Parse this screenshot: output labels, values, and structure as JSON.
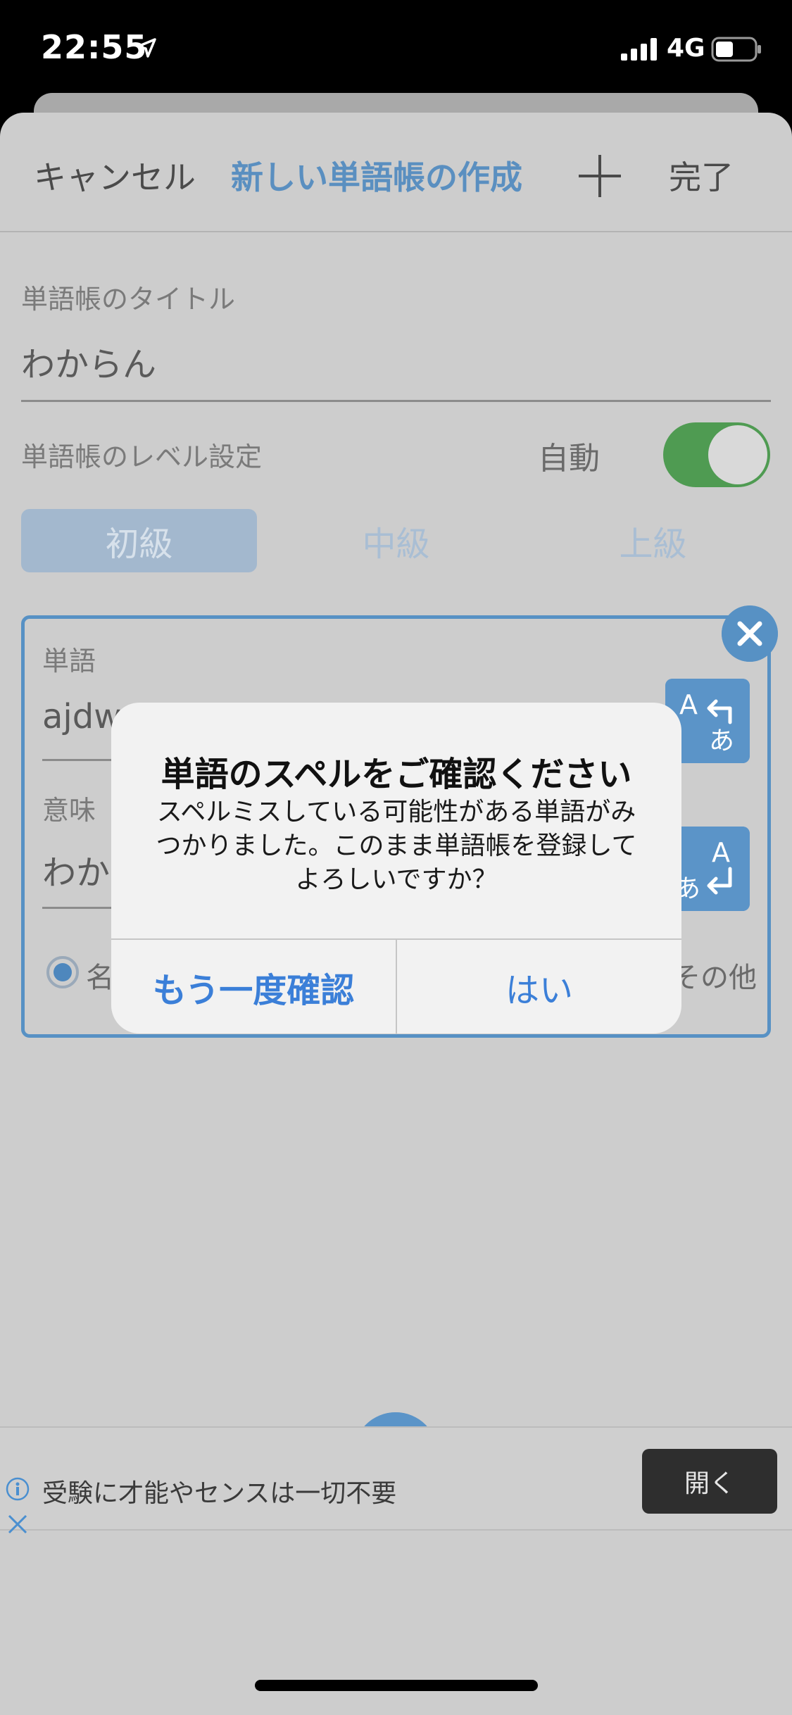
{
  "status_bar": {
    "time": "22:55",
    "network": "4G"
  },
  "nav": {
    "cancel_label": "キャンセル",
    "title": "新しい単語帳の作成",
    "done_label": "完了"
  },
  "form": {
    "title_label": "単語帳のタイトル",
    "title_value": "わからん",
    "level_label": "単語帳のレベル設定",
    "auto_label": "自動",
    "auto_enabled": true,
    "levels": [
      {
        "label": "初級",
        "selected": true
      },
      {
        "label": "中級",
        "selected": false
      },
      {
        "label": "上級",
        "selected": false
      }
    ]
  },
  "word_card": {
    "word_label": "単語",
    "word_value": "ajdw",
    "meaning_label": "意味",
    "meaning_value": "わか",
    "part_of_speech_selected": "名",
    "part_of_speech_other": "その他"
  },
  "dialog": {
    "title": "単語のスペルをご確認ください",
    "message": "スペルミスしている可能性がある単語がみつかりました。このまま単語帳を登録してよろしいですか？",
    "recheck_label": "もう一度確認",
    "yes_label": "はい"
  },
  "ad": {
    "text": "受験に才能やセンスは一切不要",
    "open_label": "開く"
  },
  "colors": {
    "accent": "#5b94c8",
    "toggle_on": "#4f9b52",
    "dialog_button": "#3b7fd8"
  }
}
